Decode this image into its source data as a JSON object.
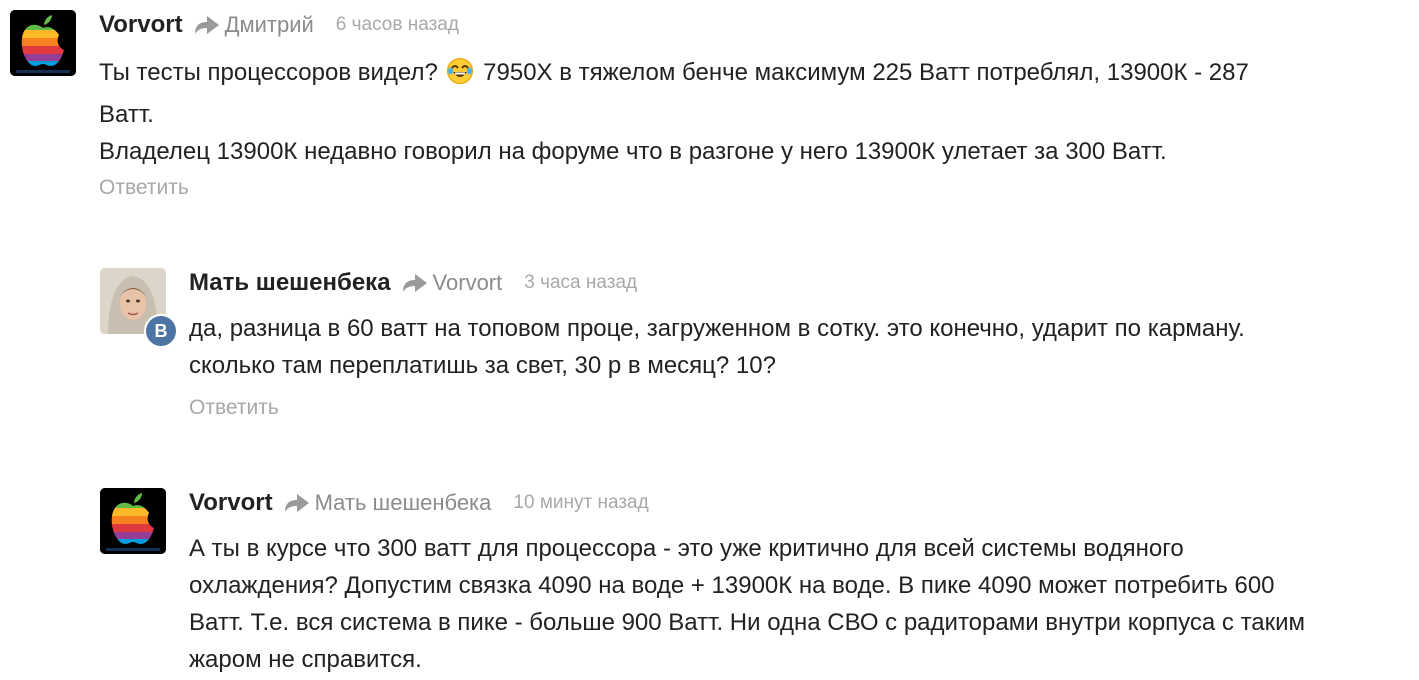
{
  "comments": [
    {
      "author": "Vorvort",
      "reply_to": "Дмитрий",
      "time": "6 часов назад",
      "lines": [
        "Ты тесты процессоров видел?",
        "7950X в тяжелом бенче максимум 225 Ватт потреблял, 13900К - 287",
        "Ватт.",
        "Владелец 13900К недавно говорил на форуме что в разгоне у него 13900К улетает за 300 Ватт."
      ],
      "emoji": "tears-of-joy-emoji",
      "reply_label": "Ответить",
      "avatar": "apple-rainbow-logo"
    },
    {
      "author": "Мать шешенбека",
      "reply_to": "Vorvort",
      "time": "3 часа назад",
      "lines": [
        "да, разница в 60 ватт на топовом проце, загруженном в сотку. это конечно, ударит по карману.",
        "сколько там переплатишь за свет, 30 р в месяц? 10?"
      ],
      "reply_label": "Ответить",
      "avatar": "user-photo",
      "badge": "В"
    },
    {
      "author": "Vorvort",
      "reply_to": "Мать шешенбека",
      "time": "10 минут назад",
      "lines": [
        "А ты в курсе что 300 ватт для процессора - это уже критично для всей системы водяного",
        "охлаждения? Допустим связка 4090 на воде + 13900К на воде. В пике 4090 может потребить 600",
        "Ватт. Т.е. вся система в пике - больше 900 Ватт. Ни одна СВО с радиторами внутри корпуса с таким",
        "жаром не справится."
      ],
      "avatar": "apple-rainbow-logo"
    }
  ],
  "colors": {
    "text": "#222222",
    "muted": "#8c8c8c",
    "time": "#a8a8a8",
    "vk_badge": "#4c75a3"
  }
}
